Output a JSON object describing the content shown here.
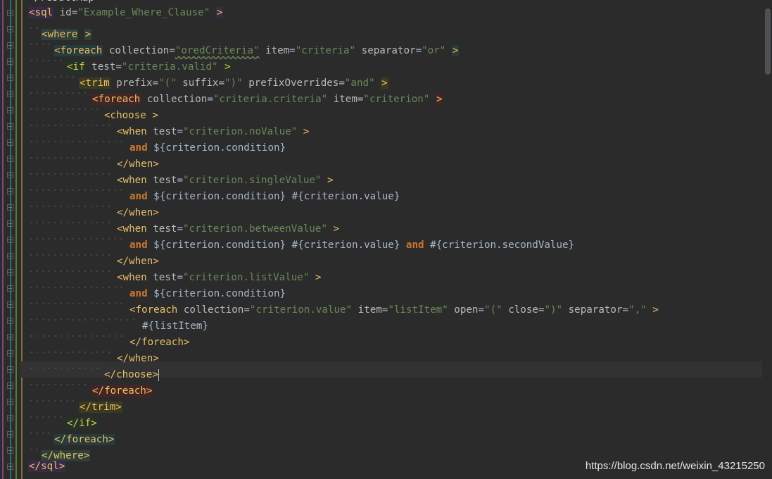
{
  "editor": {
    "top_partial_text": "</resultMap>",
    "watermark": "https://blog.csdn.net/weixin_43215250",
    "colors": {
      "background": "#2b2b2b",
      "tag": "#e8bf6a",
      "attribute": "#bababa",
      "string": "#6a8759",
      "keyword": "#cc7832",
      "text": "#a9b7c6"
    },
    "lines": [
      {
        "indent": 0,
        "bg": "#3a2a45",
        "parts": [
          [
            "t",
            "<sql"
          ],
          [
            "a",
            " id"
          ],
          [
            "p",
            "="
          ],
          [
            "v",
            "\"Example_Where_Clause\""
          ],
          [
            "p",
            " "
          ],
          [
            "t",
            ">"
          ]
        ]
      },
      {
        "indent": 1,
        "bg": "#2f4038",
        "parts": [
          [
            "t",
            "<where"
          ],
          [
            "p",
            " "
          ],
          [
            "t",
            ">"
          ]
        ]
      },
      {
        "indent": 2,
        "bg": "#273b3a",
        "parts": [
          [
            "t",
            "<foreach"
          ],
          [
            "a",
            " collection"
          ],
          [
            "p",
            "="
          ],
          [
            "v",
            "\"oredCriteria\"",
            true
          ],
          [
            "a",
            " item"
          ],
          [
            "p",
            "="
          ],
          [
            "v",
            "\"criteria\""
          ],
          [
            "a",
            " separator"
          ],
          [
            "p",
            "="
          ],
          [
            "v",
            "\"or\""
          ],
          [
            "p",
            " "
          ],
          [
            "t",
            ">"
          ]
        ]
      },
      {
        "indent": 3,
        "bg": "#223524",
        "parts": [
          [
            "t",
            "<if"
          ],
          [
            "a",
            " test"
          ],
          [
            "p",
            "="
          ],
          [
            "v",
            "\"criteria.valid\""
          ],
          [
            "p",
            " "
          ],
          [
            "t",
            ">"
          ]
        ]
      },
      {
        "indent": 4,
        "bg": "#3c3a1e",
        "parts": [
          [
            "t",
            "<trim"
          ],
          [
            "a",
            " prefix"
          ],
          [
            "p",
            "="
          ],
          [
            "v",
            "\"(\""
          ],
          [
            "a",
            " suffix"
          ],
          [
            "p",
            "="
          ],
          [
            "v",
            "\")\""
          ],
          [
            "a",
            " prefixOverrides"
          ],
          [
            "p",
            "="
          ],
          [
            "v",
            "\"and\""
          ],
          [
            "p",
            " "
          ],
          [
            "t",
            ">"
          ]
        ]
      },
      {
        "indent": 5,
        "bg": "#472424",
        "parts": [
          [
            "t",
            "<foreach"
          ],
          [
            "a",
            " collection"
          ],
          [
            "p",
            "="
          ],
          [
            "v",
            "\"criteria.criteria\""
          ],
          [
            "a",
            " item"
          ],
          [
            "p",
            "="
          ],
          [
            "v",
            "\"criterion\""
          ],
          [
            "p",
            " "
          ],
          [
            "t",
            ">"
          ]
        ]
      },
      {
        "indent": 6,
        "bg": "#2b2b2b",
        "parts": [
          [
            "t",
            "<choose"
          ],
          [
            "p",
            " "
          ],
          [
            "t",
            ">"
          ]
        ]
      },
      {
        "indent": 7,
        "bg": "#2b2b2b",
        "parts": [
          [
            "t",
            "<when"
          ],
          [
            "a",
            " test"
          ],
          [
            "p",
            "="
          ],
          [
            "v",
            "\"criterion.noValue\""
          ],
          [
            "p",
            " "
          ],
          [
            "t",
            ">"
          ]
        ]
      },
      {
        "indent": 8,
        "bg": "#2b2b2b",
        "parts": [
          [
            "k",
            "and"
          ],
          [
            "p",
            " ${criterion.condition}"
          ]
        ]
      },
      {
        "indent": 7,
        "bg": "#2b2b2b",
        "parts": [
          [
            "t",
            "</when>"
          ]
        ]
      },
      {
        "indent": 7,
        "bg": "#2b2b2b",
        "parts": [
          [
            "t",
            "<when"
          ],
          [
            "a",
            " test"
          ],
          [
            "p",
            "="
          ],
          [
            "v",
            "\"criterion.singleValue\""
          ],
          [
            "p",
            " "
          ],
          [
            "t",
            ">"
          ]
        ]
      },
      {
        "indent": 8,
        "bg": "#2b2b2b",
        "parts": [
          [
            "k",
            "and"
          ],
          [
            "p",
            " ${criterion.condition} #{criterion.value}"
          ]
        ]
      },
      {
        "indent": 7,
        "bg": "#2b2b2b",
        "parts": [
          [
            "t",
            "</when>"
          ]
        ]
      },
      {
        "indent": 7,
        "bg": "#2b2b2b",
        "parts": [
          [
            "t",
            "<when"
          ],
          [
            "a",
            " test"
          ],
          [
            "p",
            "="
          ],
          [
            "v",
            "\"criterion.betweenValue\""
          ],
          [
            "p",
            " "
          ],
          [
            "t",
            ">"
          ]
        ]
      },
      {
        "indent": 8,
        "bg": "#2b2b2b",
        "parts": [
          [
            "k",
            "and"
          ],
          [
            "p",
            " ${criterion.condition} #{criterion.value} "
          ],
          [
            "k",
            "and"
          ],
          [
            "p",
            " #{criterion.secondValue}"
          ]
        ]
      },
      {
        "indent": 7,
        "bg": "#2b2b2b",
        "parts": [
          [
            "t",
            "</when>"
          ]
        ]
      },
      {
        "indent": 7,
        "bg": "#2b2b2b",
        "parts": [
          [
            "t",
            "<when"
          ],
          [
            "a",
            " test"
          ],
          [
            "p",
            "="
          ],
          [
            "v",
            "\"criterion.listValue\""
          ],
          [
            "p",
            " "
          ],
          [
            "t",
            ">"
          ]
        ]
      },
      {
        "indent": 8,
        "bg": "#2b2b2b",
        "parts": [
          [
            "k",
            "and"
          ],
          [
            "p",
            " ${criterion.condition}"
          ]
        ]
      },
      {
        "indent": 8,
        "bg": "#2b2b2b",
        "parts": [
          [
            "t",
            "<foreach"
          ],
          [
            "a",
            " collection"
          ],
          [
            "p",
            "="
          ],
          [
            "v",
            "\"criterion.value\""
          ],
          [
            "a",
            " item"
          ],
          [
            "p",
            "="
          ],
          [
            "v",
            "\"listItem\""
          ],
          [
            "a",
            " open"
          ],
          [
            "p",
            "="
          ],
          [
            "v",
            "\"(\""
          ],
          [
            "a",
            " close"
          ],
          [
            "p",
            "="
          ],
          [
            "v",
            "\")\""
          ],
          [
            "a",
            " separator"
          ],
          [
            "p",
            "="
          ],
          [
            "v",
            "\",\""
          ],
          [
            "p",
            " "
          ],
          [
            "t",
            ">"
          ]
        ]
      },
      {
        "indent": 9,
        "bg": "#2b2b2b",
        "parts": [
          [
            "p",
            "#{listItem}"
          ]
        ]
      },
      {
        "indent": 8,
        "bg": "#2b2b2b",
        "parts": [
          [
            "t",
            "</foreach>"
          ]
        ]
      },
      {
        "indent": 7,
        "bg": "#2b2b2b",
        "parts": [
          [
            "t",
            "</when>"
          ]
        ]
      },
      {
        "indent": 6,
        "bg": "#2b2b2b",
        "parts": [
          [
            "t",
            "</choose>"
          ]
        ],
        "caret": true
      },
      {
        "indent": 5,
        "bg": "#472424",
        "parts": [
          [
            "t",
            "</foreach>"
          ]
        ]
      },
      {
        "indent": 4,
        "bg": "#3c3a1e",
        "parts": [
          [
            "t",
            "</trim>"
          ]
        ]
      },
      {
        "indent": 3,
        "bg": "#223524",
        "parts": [
          [
            "t",
            "</if>"
          ]
        ]
      },
      {
        "indent": 2,
        "bg": "#273b3a",
        "parts": [
          [
            "t",
            "</foreach>"
          ]
        ]
      },
      {
        "indent": 1,
        "bg": "#2f4038",
        "parts": [
          [
            "t",
            "</where>"
          ]
        ]
      },
      {
        "indent": 0,
        "bg": "#3a2a45",
        "parts": [
          [
            "t",
            "</sql>"
          ]
        ]
      }
    ]
  }
}
